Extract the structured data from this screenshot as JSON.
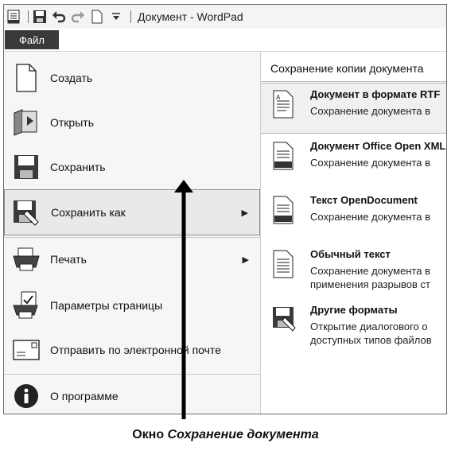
{
  "window": {
    "title": "Документ - WordPad"
  },
  "ribbon": {
    "file_tab": "Файл"
  },
  "file_menu": {
    "items": [
      {
        "label": "Создать",
        "icon": "new-document-icon"
      },
      {
        "label": "Открыть",
        "icon": "open-folder-icon"
      },
      {
        "label": "Сохранить",
        "icon": "save-disk-icon"
      },
      {
        "label": "Сохранить как",
        "icon": "save-as-icon",
        "selected": true,
        "submenu": true
      },
      {
        "label": "Печать",
        "icon": "printer-icon",
        "submenu": true
      },
      {
        "label": "Параметры страницы",
        "icon": "page-setup-icon"
      },
      {
        "label": "Отправить по электронной почте",
        "icon": "email-icon"
      },
      {
        "label": "О программе",
        "icon": "info-icon"
      }
    ]
  },
  "save_pane": {
    "header": "Сохранение копии документа",
    "options": [
      {
        "title": "Документ в формате RTF",
        "desc": [
          "Сохранение документа в"
        ],
        "selected": true,
        "icon": "rtf-file-icon"
      },
      {
        "title": "Документ Office Open XML",
        "desc": [
          "Сохранение документа в"
        ],
        "icon": "docx-file-icon"
      },
      {
        "title": "Текст OpenDocument",
        "desc": [
          "Сохранение документа в"
        ],
        "icon": "odt-file-icon"
      },
      {
        "title": "Обычный текст",
        "desc": [
          "Сохранение документа в",
          "применения разрывов ст"
        ],
        "icon": "txt-file-icon"
      },
      {
        "title": "Другие форматы",
        "desc": [
          "Открытие диалогового о",
          "доступных типов файлов"
        ],
        "icon": "other-formats-icon"
      }
    ]
  },
  "caption": {
    "prefix": "Окно ",
    "italic": "Сохранение документа"
  }
}
